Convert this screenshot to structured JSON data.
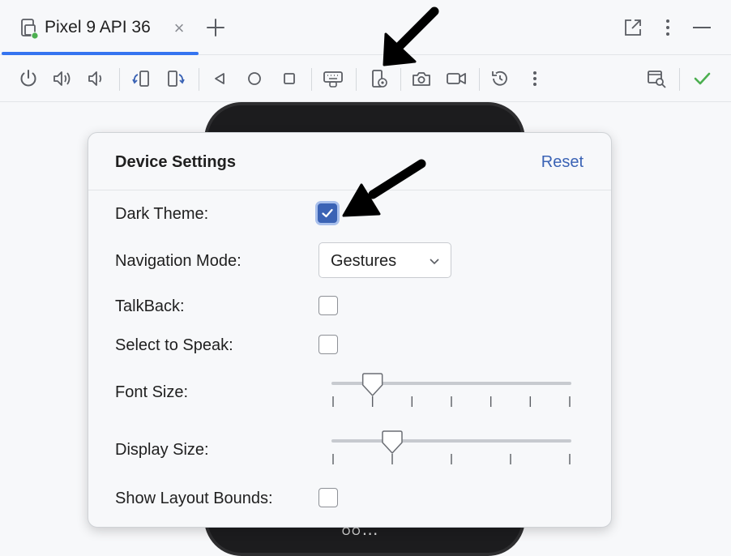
{
  "tab": {
    "title": "Pixel 9 API 36",
    "close_glyph": "×"
  },
  "tab_actions": [
    "new-tab-icon",
    "open-external-icon",
    "more-vert-icon",
    "minimize-icon"
  ],
  "toolbar": {
    "icons": [
      "power-icon",
      "volume-up-icon",
      "volume-down-icon",
      "rotate-left-icon",
      "rotate-right-icon",
      "back-icon",
      "home-icon",
      "overview-icon",
      "keyboard-icon",
      "device-settings-icon",
      "screenshot-icon",
      "screen-record-icon",
      "snapshot-icon",
      "more-vert-icon",
      "layout-inspector-icon",
      "check-icon"
    ],
    "accent_check": "#4caf50"
  },
  "popup": {
    "title": "Device Settings",
    "reset_label": "Reset",
    "rows": {
      "dark_theme": {
        "label": "Dark Theme:",
        "checked": true
      },
      "navigation_mode": {
        "label": "Navigation Mode:",
        "value": "Gestures"
      },
      "talkback": {
        "label": "TalkBack:",
        "checked": false
      },
      "select_to_speak": {
        "label": "Select to Speak:",
        "checked": false
      },
      "font_size": {
        "label": "Font Size:",
        "ticks": 7,
        "level_index": 1
      },
      "display_size": {
        "label": "Display Size:",
        "ticks": 5,
        "level_index": 1
      },
      "show_layout_bounds": {
        "label": "Show Layout Bounds:",
        "checked": false
      }
    }
  },
  "colors": {
    "accent": "#3b63b5",
    "tab_underline": "#3574f0",
    "annotation_arrow": "#000000"
  }
}
